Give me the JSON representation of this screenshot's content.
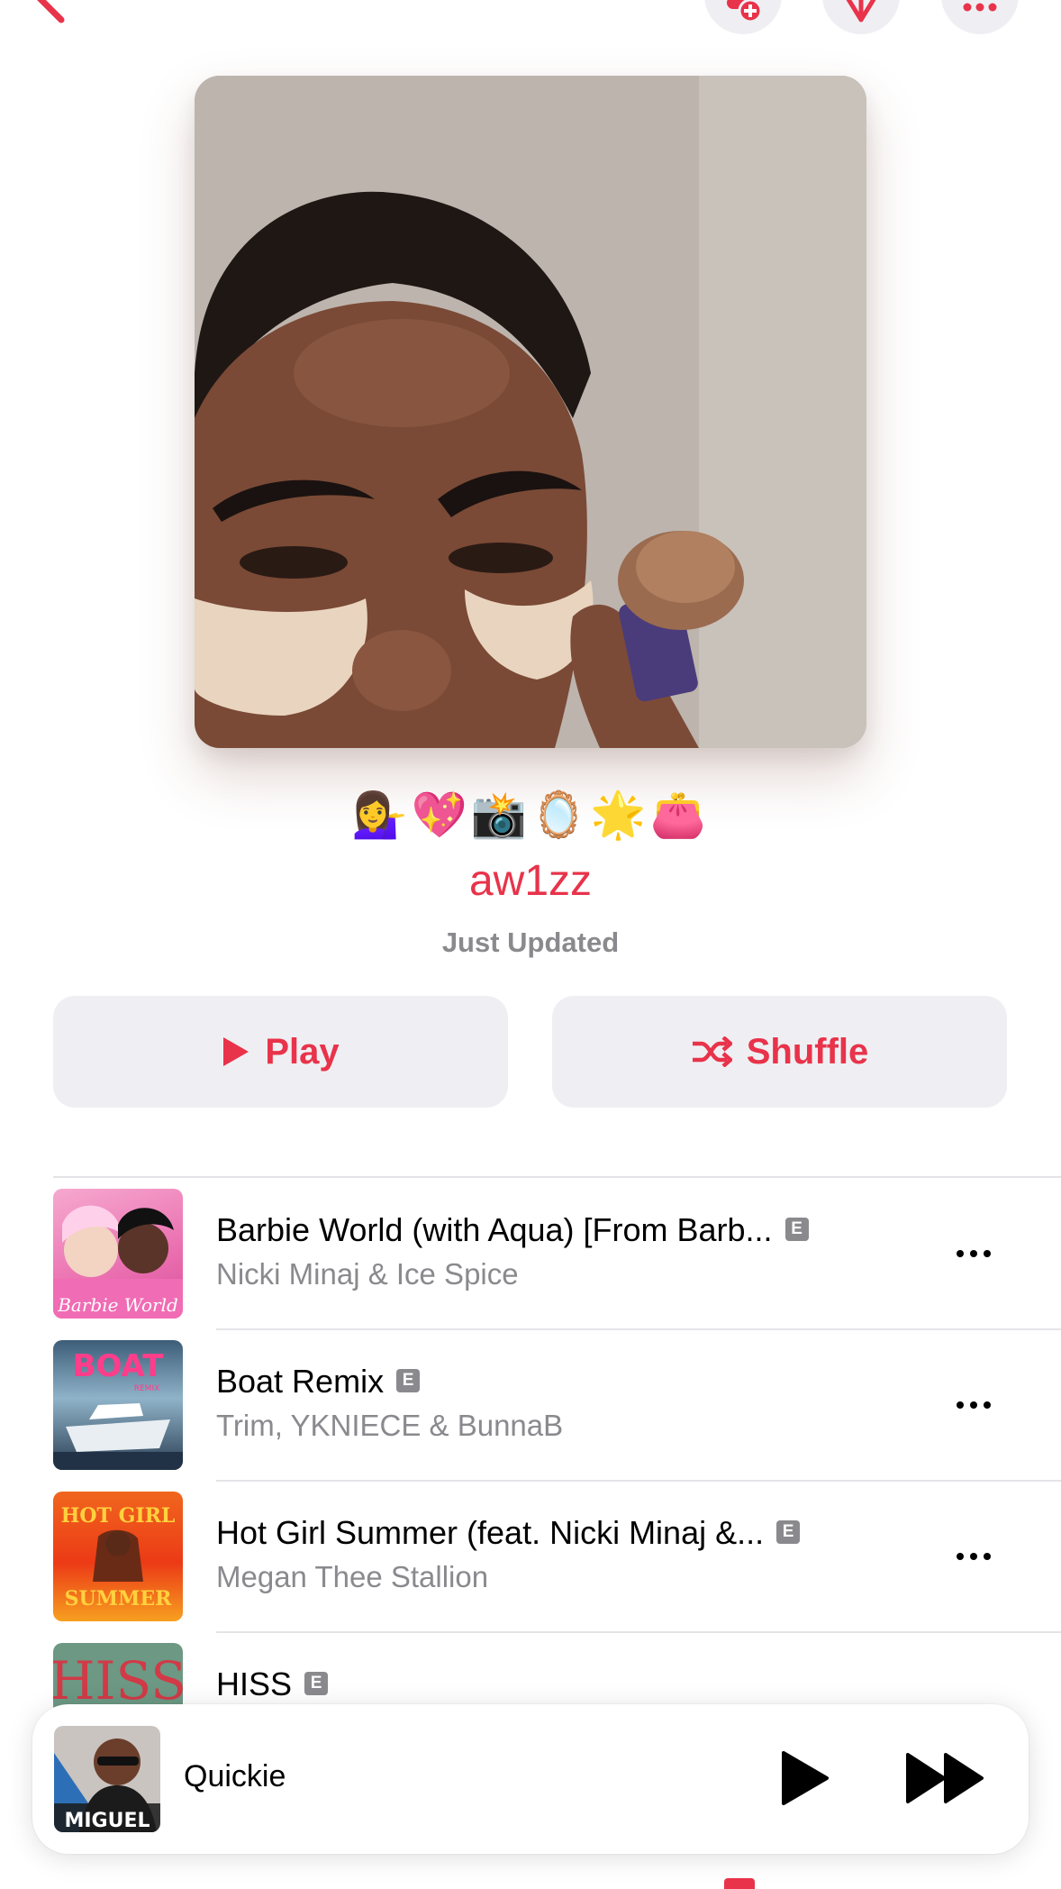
{
  "header": {
    "emoji": "💁‍♀️💖📸🪞🌟👛",
    "title": "aw1zz",
    "subtitle": "Just Updated"
  },
  "actions": {
    "play_label": "Play",
    "shuffle_label": "Shuffle"
  },
  "tracks": [
    {
      "title": "Barbie World (with Aqua) [From Barb...",
      "artist": "Nicki Minaj & Ice Spice",
      "explicit": "E",
      "art_text": "Barbie World"
    },
    {
      "title": "Boat Remix",
      "artist": "Trim, YKNIECE & BunnaB",
      "explicit": "E",
      "art_text": "BOAT",
      "art_text_2": "REMIX"
    },
    {
      "title": "Hot Girl Summer (feat. Nicki Minaj &...",
      "artist": "Megan Thee Stallion",
      "explicit": "E",
      "art_text": "HOT GIRL",
      "art_text_2": "SUMMER"
    },
    {
      "title": "HISS",
      "artist": "",
      "explicit": "E",
      "art_text": "HISS"
    }
  ],
  "now_playing": {
    "title": "Quickie",
    "art_text": "MIGUEL"
  },
  "colors": {
    "accent": "#e8334a",
    "button_bg": "#efeff3",
    "secondary_text": "#8a8a8e"
  },
  "icons": [
    "back-chevron-icon",
    "add-person-icon",
    "download-icon",
    "more-icon",
    "play-icon",
    "shuffle-icon",
    "explicit-icon",
    "fast-forward-icon"
  ]
}
